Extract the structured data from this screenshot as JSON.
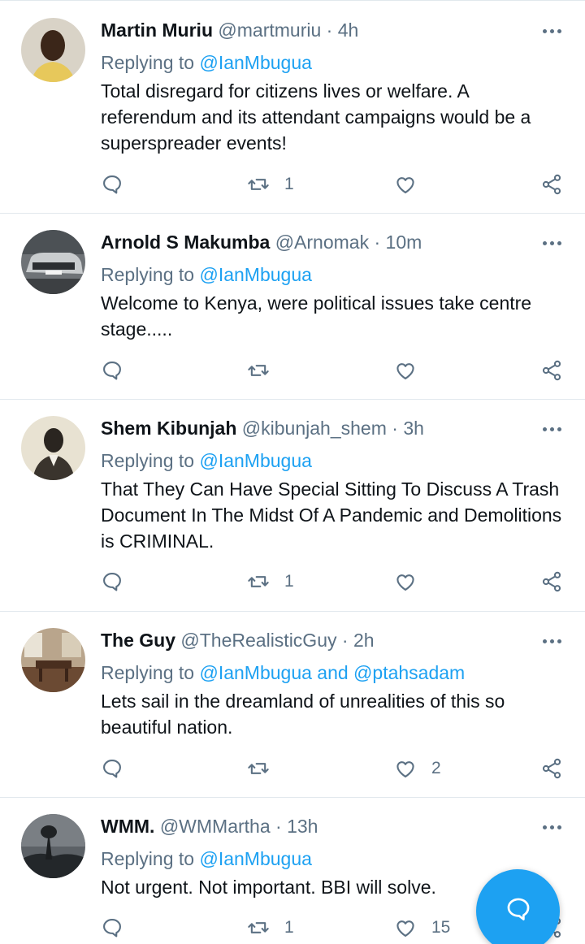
{
  "tweets": [
    {
      "name": "Martin Muriu",
      "handle": "@martmuriu",
      "time": "4h",
      "reply_prefix": "Replying to",
      "reply_to": "@IanMbugua",
      "text": "Total disregard for citizens lives or welfare. A referendum and its attendant campaigns would be a superspreader events!",
      "retweets": "1",
      "likes": "",
      "avatar_bg": "#d9d3c7"
    },
    {
      "name": "Arnold S Makumba",
      "handle": "@Arnomak",
      "time": "10m",
      "reply_prefix": "Replying to",
      "reply_to": "@IanMbugua",
      "text": "Welcome to Kenya, were political issues take centre stage.....",
      "retweets": "",
      "likes": "",
      "avatar_bg": "#6f7377"
    },
    {
      "name": "Shem Kibunjah",
      "handle": "@kibunjah_shem",
      "time": "3h",
      "reply_prefix": "Replying to",
      "reply_to": "@IanMbugua",
      "text": "That They Can Have  Special Sitting To Discuss A Trash Document In The Midst Of A Pandemic and Demolitions is CRIMINAL.",
      "retweets": "1",
      "likes": "",
      "avatar_bg": "#e8e2d2"
    },
    {
      "name": "The Guy",
      "handle": "@TheRealisticGuy",
      "time": "2h",
      "reply_prefix": "Replying to",
      "reply_to": "@IanMbugua and @ptahsadam",
      "text": "Lets sail in the dreamland of unrealities of this so beautiful nation.",
      "retweets": "",
      "likes": "2",
      "avatar_bg": "#8a6a4f"
    },
    {
      "name": "WMM.",
      "handle": "@WMMartha",
      "time": "13h",
      "reply_prefix": "Replying to",
      "reply_to": "@IanMbugua",
      "text": "Not urgent. Not important. BBI will solve.",
      "retweets": "1",
      "likes": "15",
      "avatar_bg": "#3d4146"
    }
  ],
  "colors": {
    "accent": "#1da1f2",
    "secondary_text": "#5b7083",
    "divider": "#e1e8ed"
  },
  "icons": {
    "reply": "reply-icon",
    "retweet": "retweet-icon",
    "like": "heart-icon",
    "share": "share-icon",
    "more": "more-icon",
    "compose": "compose-reply-icon"
  }
}
